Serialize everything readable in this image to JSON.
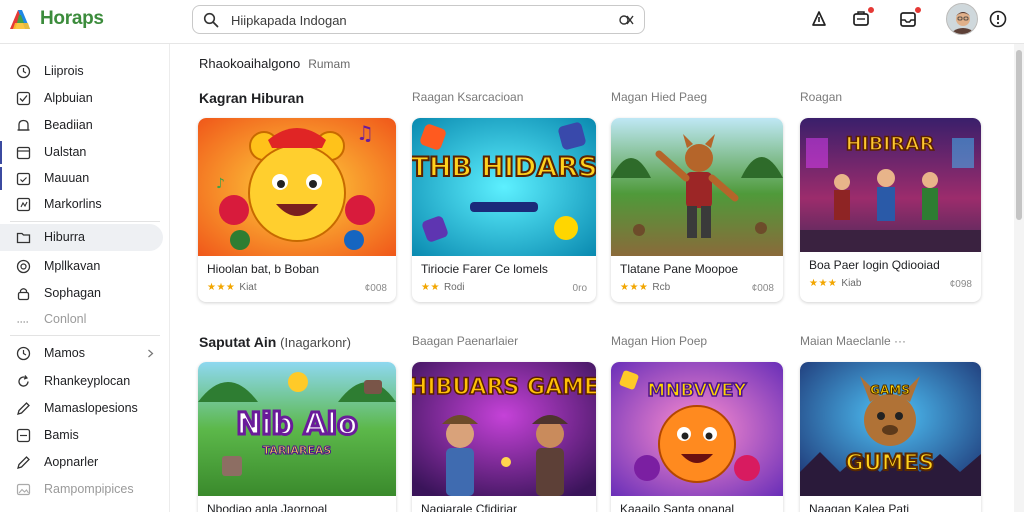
{
  "app": {
    "name": "Horaps",
    "brand_color": "#3c8c3c"
  },
  "search": {
    "value": "Hiipkapada Indogan",
    "icon": "search-icon",
    "clear_icon": "clear-search-icon"
  },
  "toolbar": {
    "icons": [
      "share-icon",
      "notifications-icon",
      "inbox-icon",
      "help-icon"
    ],
    "badge_color": "#e53935"
  },
  "sidebar": {
    "items": [
      {
        "label": "Liiprois",
        "icon": "clock-icon"
      },
      {
        "label": "Alpbuian",
        "icon": "check-box-icon"
      },
      {
        "label": "Beadiian",
        "icon": "bell-icon"
      },
      {
        "label": "Ualstan",
        "icon": "calendar-icon"
      },
      {
        "label": "Mauuan",
        "icon": "calendar-check-icon"
      },
      {
        "label": "Markorlins",
        "icon": "grid-icon"
      },
      {
        "label": "Hiburra",
        "icon": "folder-icon"
      },
      {
        "label": "Mpllkavan",
        "icon": "target-icon"
      },
      {
        "label": "Sophagan",
        "icon": "lock-icon"
      },
      {
        "label": "Conlonl",
        "icon": "dots-icon"
      },
      {
        "label": "Mamos",
        "icon": "clock-icon"
      },
      {
        "label": "Rhankeyplocan",
        "icon": "refresh-icon"
      },
      {
        "label": "Mamaslopesions",
        "icon": "pen-icon"
      },
      {
        "label": "Bamis",
        "icon": "check-box-icon"
      },
      {
        "label": "Aopnarler",
        "icon": "pen-icon"
      },
      {
        "label": "Rampompipices",
        "icon": "image-icon"
      }
    ]
  },
  "main": {
    "breadcrumb": {
      "title": "Rhaokoaihalgono",
      "sub": "Rumam"
    },
    "rows": [
      {
        "title": "Kagran Hiburan",
        "title_suffix": "",
        "column_heads": [
          "Raagan Ksarcacioan",
          "Magan Hied Paeg",
          "Roagan"
        ],
        "cards": [
          {
            "title": "Hioolan bat, b Boban",
            "stars": "★★★",
            "rating_label": "Kiat",
            "count": "¢008"
          },
          {
            "title": "Tiriocie Farer Ce lomels",
            "stars": "★★",
            "rating_label": "Rodi",
            "count": "0ro"
          },
          {
            "title": "Tlatane Pane Moopoe",
            "stars": "★★★",
            "rating_label": "Rcb",
            "count": "¢008"
          },
          {
            "title": "Boa Paer Iogin Qdiooiad",
            "stars": "★★★",
            "rating_label": "Kiab",
            "count": "¢098"
          }
        ]
      },
      {
        "title": "Saputat Ain",
        "title_suffix": "(Inagarkonr)",
        "column_heads": [
          "Baagan Paenarlaier",
          "Magan Hion Poep",
          "Maian Maeclanle ···"
        ],
        "cards": [
          {
            "title": "Nbodiao apla Jaornoal",
            "stars": "",
            "rating_label": "",
            "count": ""
          },
          {
            "title": "Nagiarale Cfidiriar",
            "stars": "",
            "rating_label": "",
            "count": ""
          },
          {
            "title": "Kaaailo Santa onanal",
            "stars": "",
            "rating_label": "",
            "count": ""
          },
          {
            "title": "Naagan Kalea Pati",
            "stars": "",
            "rating_label": "",
            "count": ""
          }
        ]
      }
    ],
    "thumbnail_texts": [
      "THB HIDARS",
      "HIBIRAR",
      "Nib Alo",
      "TARIAREAS",
      "HIBUARS GAME",
      "MNBVVEY",
      "GAMS",
      "GUMES"
    ]
  },
  "colors": {
    "star": "#f2a600",
    "active_nav_bg": "#eef0f3",
    "nav_marker": "#3b4aa0"
  }
}
